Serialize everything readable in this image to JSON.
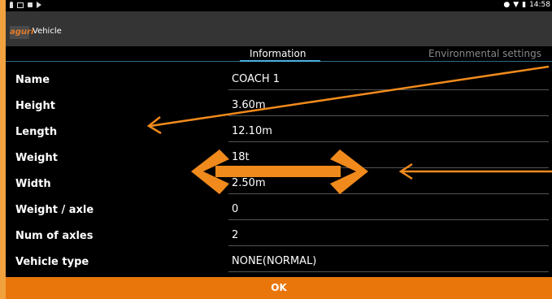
{
  "status_bar": {
    "left_icons": [
      "person-icon",
      "image-icon",
      "lock-icon",
      "play-icon"
    ],
    "right_icons": [
      "location-icon",
      "wifi-icon",
      "battery-icon"
    ],
    "time": "14:58"
  },
  "app_bar": {
    "logo_text": "aguri",
    "title": "Vehicle"
  },
  "tabs": [
    {
      "label": "Information",
      "selected": true
    },
    {
      "label": "Environmental settings",
      "selected": false
    }
  ],
  "fields": [
    {
      "label": "Name",
      "value": "COACH 1"
    },
    {
      "label": "Height",
      "value": "3.60m"
    },
    {
      "label": "Length",
      "value": "12.10m"
    },
    {
      "label": "Weight",
      "value": "18t"
    },
    {
      "label": "Width",
      "value": "2.50m"
    },
    {
      "label": "Weight / axle",
      "value": "0"
    },
    {
      "label": "Num of axles",
      "value": "2"
    },
    {
      "label": "Vehicle type",
      "value": "NONE(NORMAL)"
    }
  ],
  "ok_button": {
    "label": "OK"
  },
  "colors": {
    "accent": "#e8760b",
    "tab_indicator": "#49b1e5",
    "annotation": "#f08a1c",
    "background": "#000000",
    "app_bar": "#343434"
  }
}
